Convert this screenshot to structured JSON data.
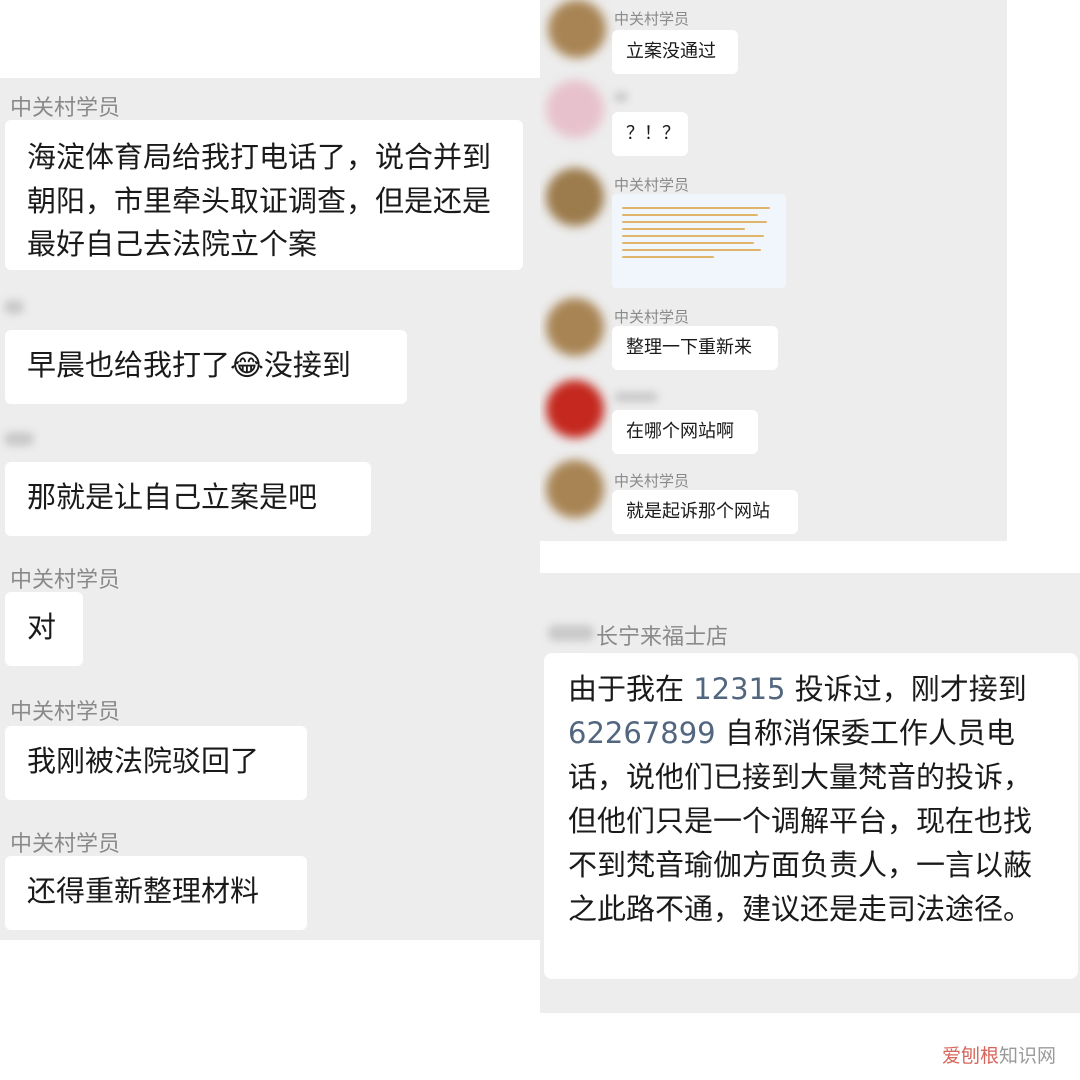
{
  "left_chat": {
    "messages": [
      {
        "sender": "中关村学员",
        "text": "海淀体育局给我打电话了，说合并到朝阳，市里牵头取证调查，但是还是最好自己去法院立个案"
      },
      {
        "sender": "",
        "text_before_emoji": "早晨也给我打了",
        "emoji": "😂",
        "text_after_emoji": "没接到"
      },
      {
        "sender": "",
        "text": "那就是让自己立案是吧"
      },
      {
        "sender": "中关村学员",
        "text": "对"
      },
      {
        "sender": "中关村学员",
        "text": "我刚被法院驳回了"
      },
      {
        "sender": "中关村学员",
        "text": "还得重新整理材料"
      }
    ]
  },
  "right_top_chat": {
    "messages": [
      {
        "sender": "中关村学员",
        "text": "立案没通过"
      },
      {
        "sender": "",
        "text": "？！？"
      },
      {
        "sender": "中关村学员",
        "text": "",
        "attachment": "document-image"
      },
      {
        "sender": "中关村学员",
        "text": "整理一下重新来"
      },
      {
        "sender": "",
        "text": "在哪个网站啊"
      },
      {
        "sender": "中关村学员",
        "text": "就是起诉那个网站"
      }
    ]
  },
  "right_bottom_chat": {
    "sender_suffix": "长宁来福士店",
    "message_parts": [
      {
        "text": "由于我在 ",
        "highlight": false
      },
      {
        "text": "12315",
        "highlight": true
      },
      {
        "text": " 投诉过，刚才接到 ",
        "highlight": false
      },
      {
        "text": "62267899",
        "highlight": true
      },
      {
        "text": " 自称消保委工作人员电话，说他们已接到大量梵音的投诉，但他们只是一个调解平台，现在也找不到梵音瑜伽方面负责人，一言以蔽之此路不通，建议还是走司法途径。",
        "highlight": false
      }
    ]
  },
  "watermark": {
    "red_part": "爱刨根",
    "grey_part": "知识网"
  },
  "colors": {
    "panel_bg": "#ededed",
    "bubble_bg": "#ffffff",
    "highlight_number": "#52667f",
    "sender_name": "#8a8a8a"
  }
}
